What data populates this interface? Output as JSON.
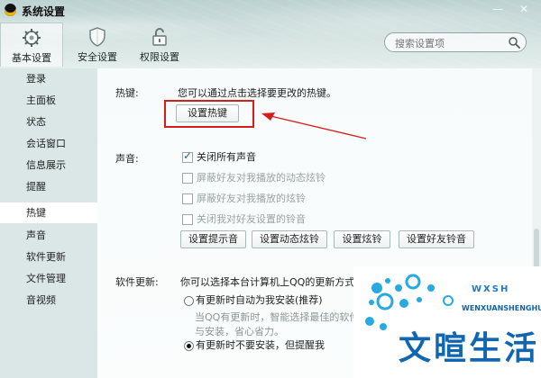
{
  "window": {
    "title": "系统设置",
    "controls": {
      "minimize": "—",
      "close": "✕"
    }
  },
  "tabs": [
    {
      "label": "基本设置",
      "icon": "gear-icon"
    },
    {
      "label": "安全设置",
      "icon": "shield-icon"
    },
    {
      "label": "权限设置",
      "icon": "lock-icon"
    }
  ],
  "search": {
    "placeholder": "搜索设置项",
    "icon": "search-icon"
  },
  "sidebar": {
    "items": [
      {
        "label": "登录"
      },
      {
        "label": "主面板"
      },
      {
        "label": "状态"
      },
      {
        "label": "会话窗口"
      },
      {
        "label": "信息展示"
      },
      {
        "label": "提醒"
      },
      {
        "label": "热键"
      },
      {
        "label": "声音"
      },
      {
        "label": "软件更新"
      },
      {
        "label": "文件管理"
      },
      {
        "label": "音视频"
      }
    ],
    "selected": "热键"
  },
  "hotkey": {
    "label": "热键:",
    "description": "您可以通过点击选择要更改的热键。",
    "button": "设置热键"
  },
  "sound": {
    "label": "声音:",
    "options": [
      {
        "label": "关闭所有声音",
        "checked": true,
        "enabled": true
      },
      {
        "label": "屏蔽好友对我播放的动态炫铃",
        "checked": false,
        "enabled": false
      },
      {
        "label": "屏蔽好友对我播放的炫铃",
        "checked": false,
        "enabled": false
      },
      {
        "label": "关闭我对好友设置的铃音",
        "checked": false,
        "enabled": false
      }
    ],
    "buttons": [
      "设置提示音",
      "设置动态炫铃",
      "设置炫铃",
      "设置好友铃音"
    ]
  },
  "update": {
    "label": "软件更新:",
    "description": "你可以选择本台计算机上QQ的更新方式:",
    "options": [
      {
        "label": "有更新时自动为我安装(推荐)",
        "checked": false
      },
      {
        "label": "有更新时不要安装，但提醒我",
        "checked": true
      }
    ],
    "subtext1": "当QQ有更新时，智能选择最佳的软件",
    "subtext2": "与安装，省心省力。"
  },
  "watermark": {
    "small": "WXSH",
    "latin": "WENXUANSHENGHUO",
    "main": "文暄生活"
  },
  "colors": {
    "accent": "#1266b0",
    "highlight": "#d51d1d",
    "selected_sidebar": "#ffffff"
  }
}
